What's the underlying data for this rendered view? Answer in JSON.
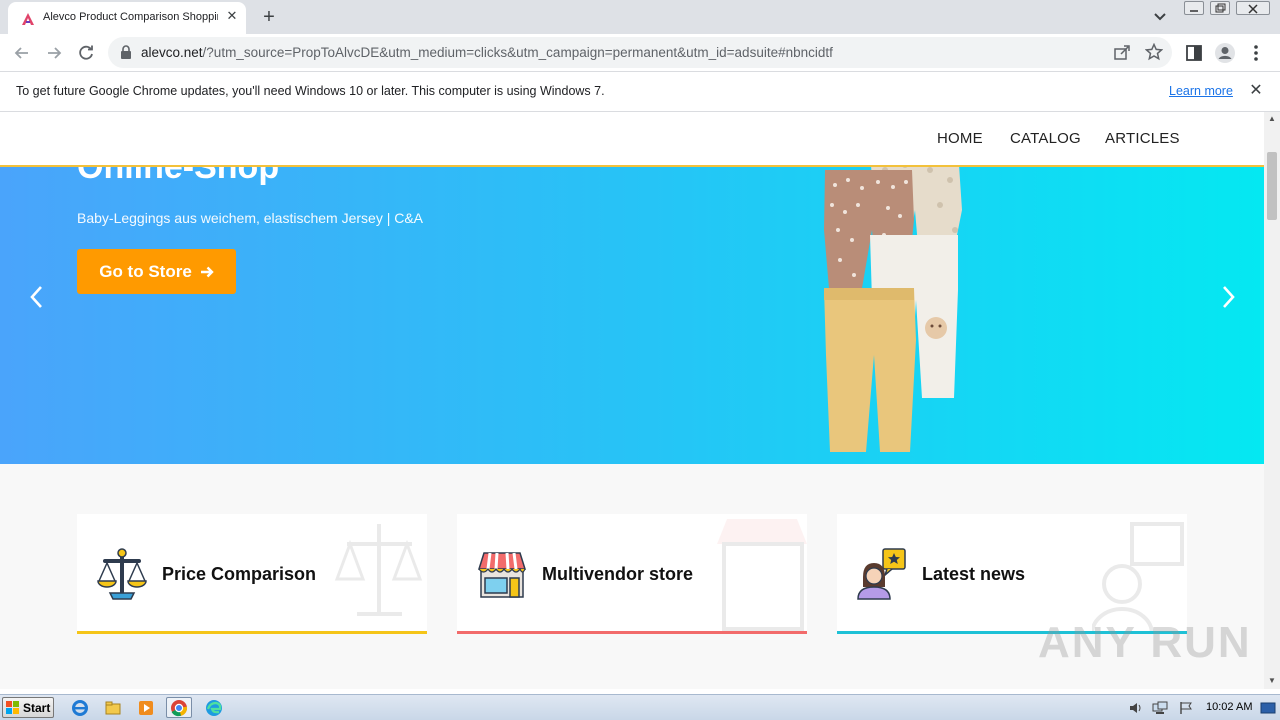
{
  "browser": {
    "tab_title": "Alevco Product Comparison Shopping",
    "url_host": "alevco.net",
    "url_rest": "/?utm_source=PropToAlvcDE&utm_medium=clicks&utm_campaign=permanent&utm_id=adsuite#nbncidtf",
    "new_tab_label": "+",
    "close_tab_label": "✕"
  },
  "infobar": {
    "message": "To get future Google Chrome updates, you'll need Windows 10 or later. This computer is using Windows 7.",
    "link": "Learn more",
    "close": "✕"
  },
  "site": {
    "nav": [
      "HOME",
      "CATALOG",
      "ARTICLES"
    ],
    "hero": {
      "title": "Online-Shop",
      "subtitle": "Baby-Leggings aus weichem, elastischem Jersey | C&A",
      "cta": "Go to Store"
    },
    "features": [
      {
        "label": "Price Comparison",
        "icon": "scales-icon",
        "accent": "#f5c518"
      },
      {
        "label": "Multivendor store",
        "icon": "store-icon",
        "accent": "#f26b6b"
      },
      {
        "label": "Latest news",
        "icon": "news-person-icon",
        "accent": "#1ec1d6"
      }
    ]
  },
  "watermark": "ANY RUN",
  "taskbar": {
    "start": "Start",
    "apps": [
      "ie-icon",
      "explorer-icon",
      "media-player-icon",
      "chrome-icon",
      "edge-icon"
    ],
    "clock": "10:02 AM"
  },
  "colors": {
    "hero_start": "#4aa4fb",
    "hero_end": "#04e8f2",
    "cta": "#ff9a00",
    "header_border": "#f3c13a"
  }
}
